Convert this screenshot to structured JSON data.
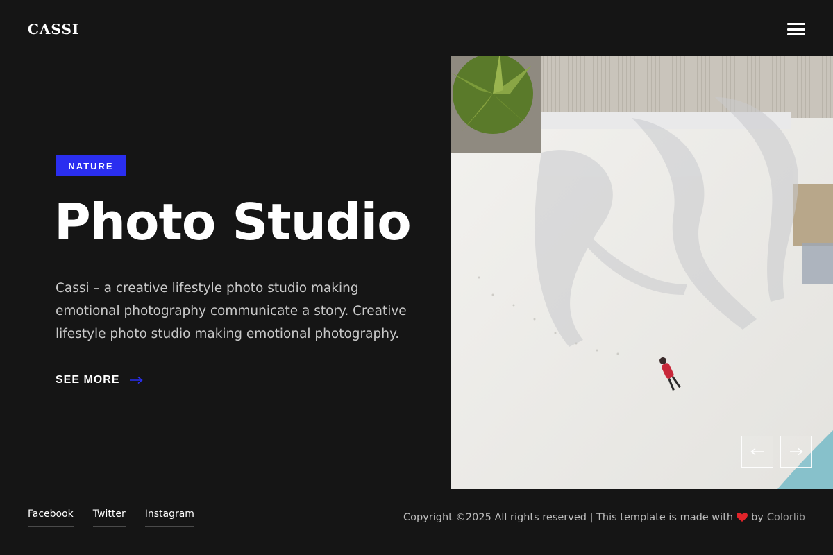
{
  "header": {
    "logo": "CASSI",
    "menu_icon": "hamburger-menu-icon"
  },
  "hero": {
    "badge": "NATURE",
    "title": "Photo Studio",
    "description": "Cassi – a creative lifestyle photo studio making emotional photography communicate a story. Creative lifestyle photo studio making emotional photography.",
    "cta_label": "SEE MORE",
    "cta_icon": "arrow-right-icon"
  },
  "slider": {
    "prev_icon": "arrow-left-icon",
    "next_icon": "arrow-right-icon"
  },
  "footer": {
    "social": [
      {
        "label": "Facebook"
      },
      {
        "label": "Twitter"
      },
      {
        "label": "Instagram"
      }
    ],
    "copyright_prefix": "Copyright ©2025 All rights reserved | This template is made with",
    "heart_icon": "heart-icon",
    "by_text": "by",
    "credit_link": "Colorlib"
  },
  "colors": {
    "background": "#151515",
    "accent": "#2a2ef0",
    "heart": "#e0242a"
  }
}
